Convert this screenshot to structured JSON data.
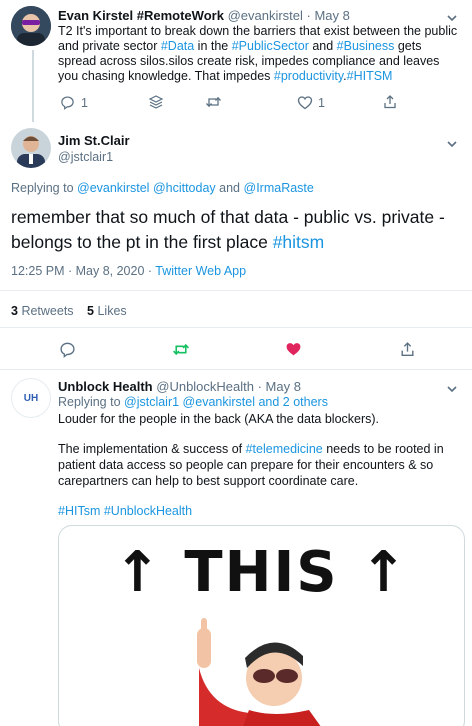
{
  "tweet1": {
    "name": "Evan Kirstel #RemoteWork",
    "handle_date": "@evankirstel · May 8",
    "body_parts": [
      {
        "t": "T2 It's important to break down the barriers that exist between the public and private sector ",
        "link": false
      },
      {
        "t": "#Data",
        "link": true
      },
      {
        "t": " in the ",
        "link": false
      },
      {
        "t": "#PublicSector",
        "link": true
      },
      {
        "t": " and ",
        "link": false
      },
      {
        "t": "#Business",
        "link": true
      },
      {
        "t": " gets spread across silos.silos create risk, impedes compliance and leaves you chasing knowledge. That impedes ",
        "link": false
      },
      {
        "t": "#productivity",
        "link": true
      },
      {
        "t": ".",
        "link": false
      },
      {
        "t": "#HITSM",
        "link": true
      }
    ],
    "reply_count": "1",
    "like_count": "1"
  },
  "tweet2": {
    "name": "Jim St.Clair",
    "handle": "@jstclair1",
    "replying_prefix": "Replying to ",
    "replying_users": [
      "@evankirstel",
      "@hcittoday",
      "@IrmaRaste"
    ],
    "replying_and": "and",
    "body_text": "remember that so much of that data - public vs. private - belongs to the pt in the first place ",
    "body_hashtag": "#hitsm",
    "timestamp": "12:25 PM · May 8, 2020 · ",
    "source": "Twitter Web App",
    "retweets_count": "3",
    "retweets_label": "Retweets",
    "likes_count": "5",
    "likes_label": "Likes"
  },
  "tweet3": {
    "name": "Unblock Health",
    "handle_date": "@UnblockHealth · May 8",
    "avatar_text": "UH",
    "replying_prefix": "Replying to ",
    "replying_users": "@jstclair1 @evankirstel and 2 others",
    "line1": "Louder for the people in the back (AKA the data blockers).",
    "para2_before": "The implementation & success of ",
    "para2_hashtag": "#telemedicine",
    "para2_after": " needs to be rooted in patient data access so people can prepare for their encounters & so carepartners can help to best support coordinate care.",
    "hashtags": "#HITsm #UnblockHealth",
    "meme_text": "↑ THIS ↑"
  },
  "colors": {
    "link": "#1b95e0",
    "muted": "#5b7083",
    "like_active": "#e0245e",
    "retweet_green": "#17bf63"
  }
}
